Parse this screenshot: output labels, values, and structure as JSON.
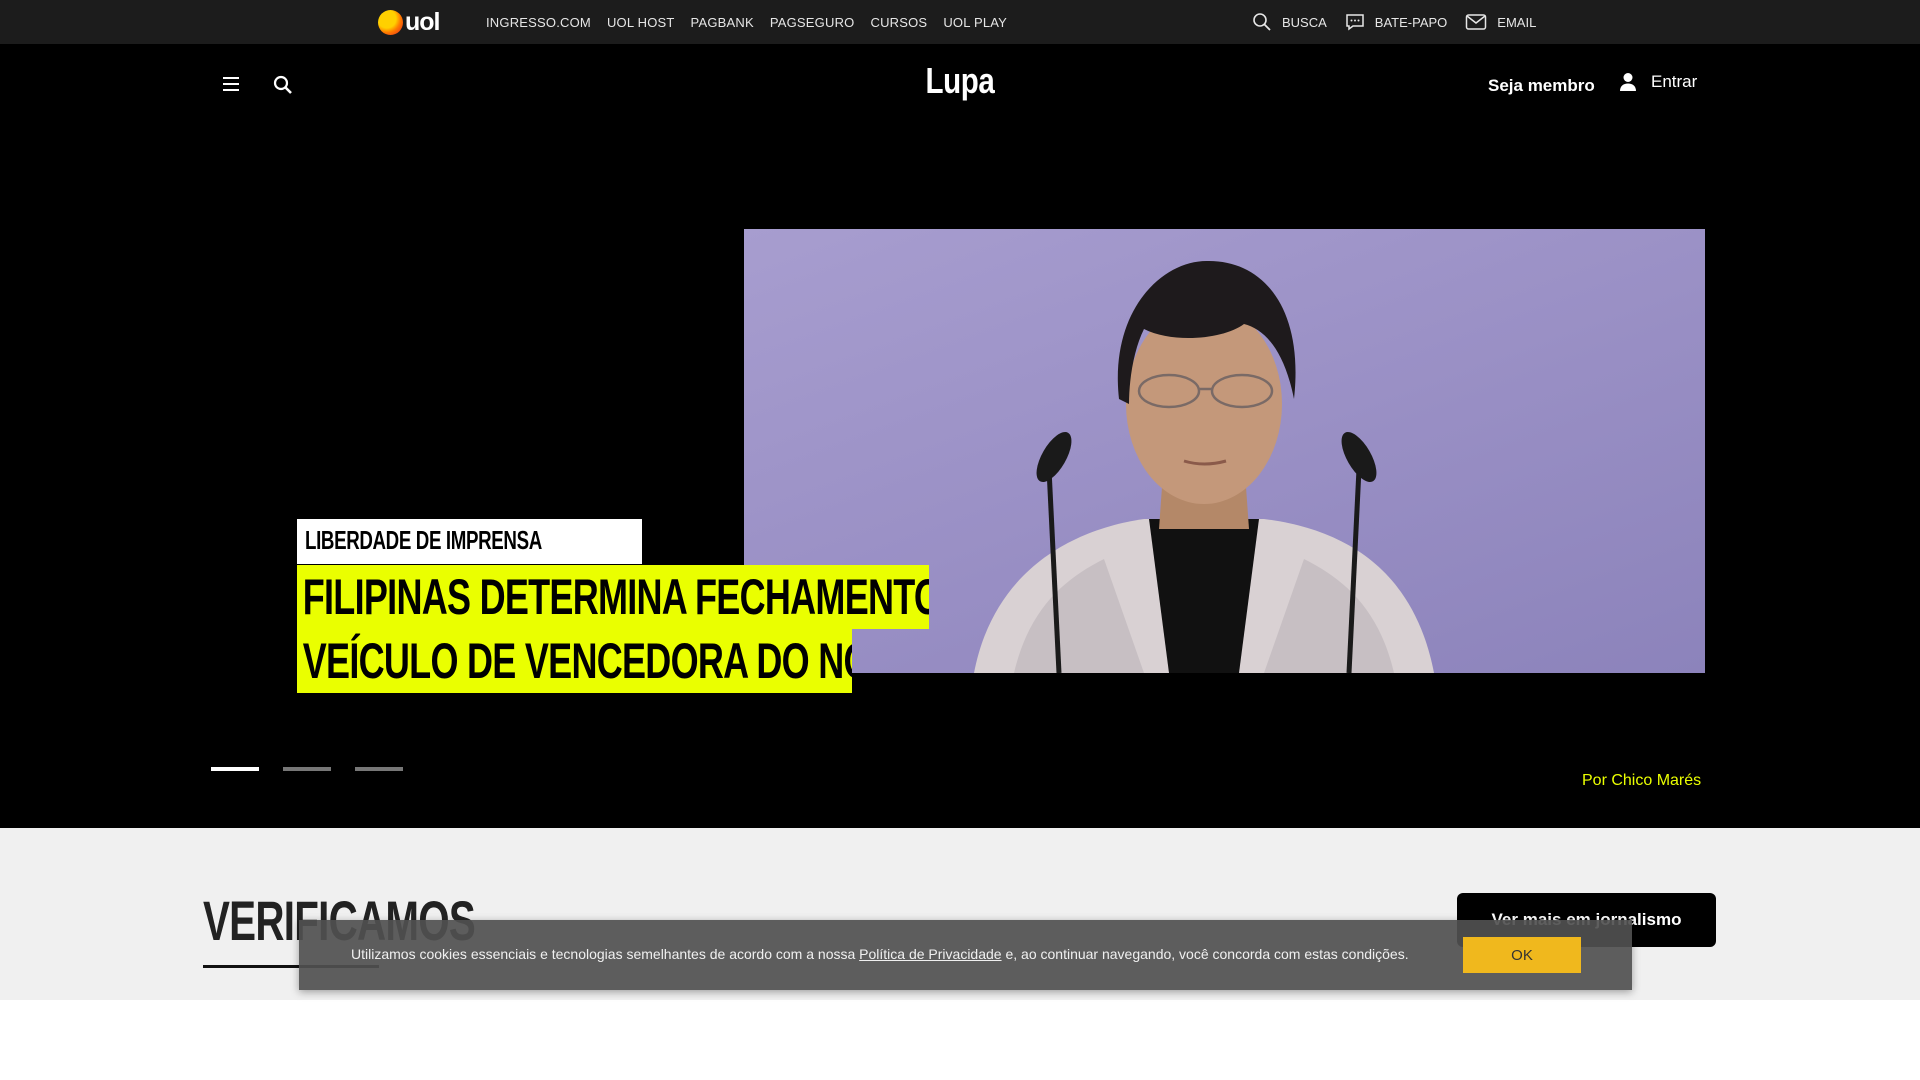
{
  "uol_bar": {
    "logo_text": "uol",
    "links": [
      "INGRESSO.COM",
      "UOL HOST",
      "PAGBANK",
      "PAGSEGURO",
      "CURSOS",
      "UOL PLAY"
    ],
    "right": {
      "search": "BUSCA",
      "chat": "BATE-PAPO",
      "email": "EMAIL"
    }
  },
  "header": {
    "logo": "Lupa",
    "member": "Seja membro",
    "login": "Entrar"
  },
  "hero": {
    "tag": "LIBERDADE DE IMPRENSA",
    "title_lines": [
      "FILIPINAS DETERMINA FECHAMENTO DE",
      "VEÍCULO DE VENCEDORA DO NOBEL"
    ],
    "byline": "Por Chico Marés",
    "slides": 3,
    "active_slide": 1
  },
  "section": {
    "title": "VERIFICAMOS",
    "more_button": "Ver mais em jornalismo"
  },
  "cookie": {
    "text_before": "Utilizamos cookies essenciais e tecnologias semelhantes de acordo com a nossa ",
    "link": "Política de Privacidade",
    "text_after": " e, ao continuar navegando, você concorda com estas condições.",
    "ok": "OK"
  },
  "colors": {
    "accent_yellow": "#eaff00",
    "cookie_button": "#f0b81d",
    "topbar": "#1c1c1c"
  }
}
